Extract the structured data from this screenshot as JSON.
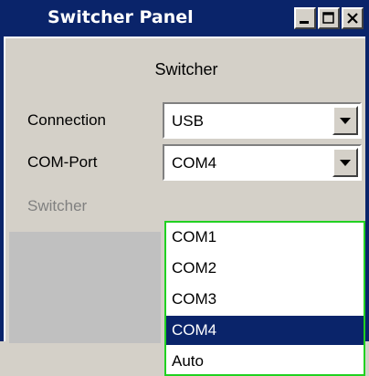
{
  "window": {
    "title": "Switcher Panel",
    "buttons": [
      "minimize",
      "maximize",
      "close"
    ]
  },
  "panel": {
    "section_title": "Switcher",
    "fields": {
      "connection": {
        "label": "Connection",
        "value": "USB"
      },
      "com_port": {
        "label": "COM-Port",
        "value": "COM4"
      },
      "switcher": {
        "label": "Switcher"
      }
    }
  },
  "dropdown": {
    "options": [
      "COM1",
      "COM2",
      "COM3",
      "COM4",
      "Auto"
    ],
    "selected": "COM4"
  },
  "colors": {
    "titlebar": "#0a246a",
    "face": "#d4d0c8",
    "list_border": "#21d121",
    "selection": "#0a246a"
  }
}
